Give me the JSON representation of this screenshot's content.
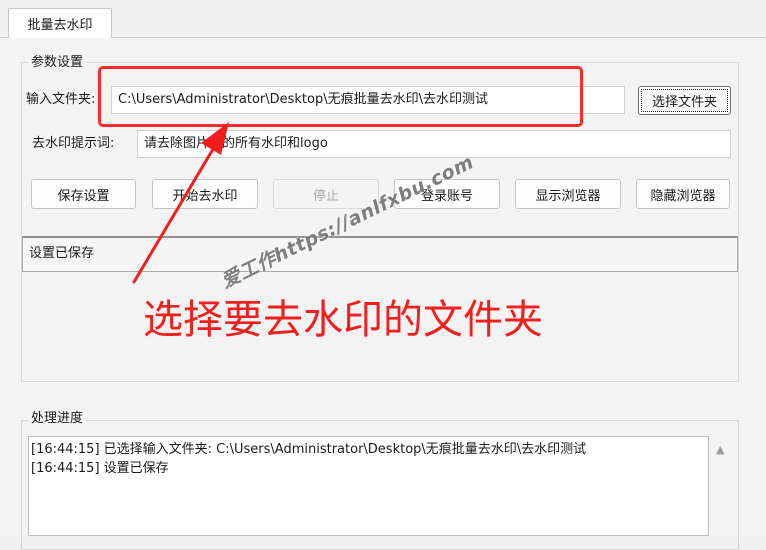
{
  "tab": {
    "label": "批量去水印"
  },
  "params_group": {
    "title": "参数设置",
    "input_folder": {
      "label": "输入文件夹:",
      "value": "C:\\Users\\Administrator\\Desktop\\无痕批量去水印\\去水印测试",
      "browse_button": "选择文件夹"
    },
    "prompt": {
      "label": "去水印提示词:",
      "value": "请去除图片上的所有水印和logo"
    },
    "buttons": {
      "save": "保存设置",
      "start": "开始去水印",
      "stop": "停止",
      "login": "登录账号",
      "show_browser": "显示浏览器",
      "hide_browser": "隐藏浏览器"
    },
    "status": "设置已保存"
  },
  "annotation": {
    "text": "选择要去水印的文件夹",
    "color": "#f21e1e"
  },
  "watermark": {
    "text": "爱工作https://anlfxbu.com"
  },
  "progress_group": {
    "title": "处理进度",
    "log_lines": [
      "[16:44:15] 已选择输入文件夹: C:\\Users\\Administrator\\Desktop\\无痕批量去水印\\去水印测试",
      "[16:44:15] 设置已保存"
    ]
  },
  "icons": {
    "scroll_up": "triangle-up-icon"
  }
}
